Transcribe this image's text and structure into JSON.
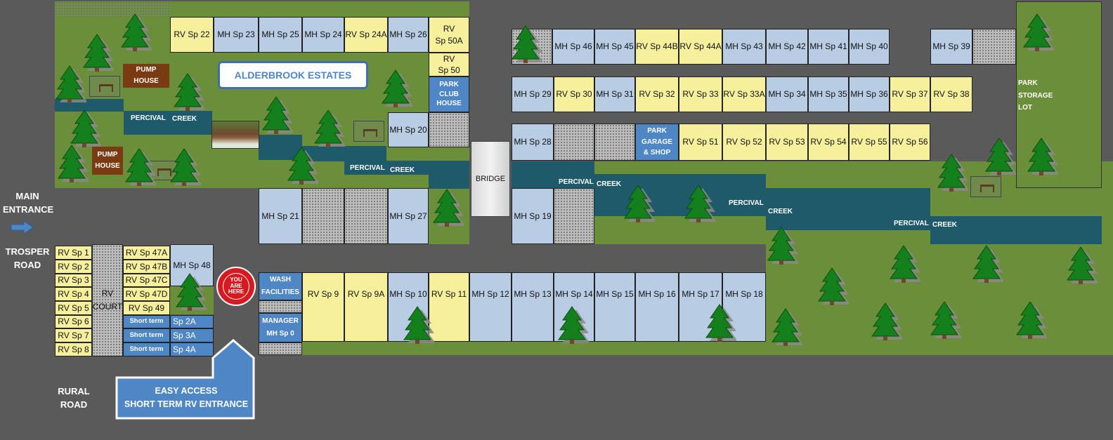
{
  "title": "ALDERBROOK ESTATES",
  "roads": {
    "main_entrance": [
      "MAIN",
      "ENTRANCE"
    ],
    "trosper_road": [
      "TROSPER",
      "ROAD"
    ],
    "rural_road": [
      "RURAL",
      "ROAD"
    ]
  },
  "easy_access": [
    "EASY ACCESS",
    "SHORT TERM RV ENTRANCE"
  ],
  "you_are_here": [
    "YOU",
    "ARE",
    "HERE"
  ],
  "bridge": "BRIDGE",
  "pump_house": [
    "PUMP",
    "HOUSE"
  ],
  "park_club_house": [
    "PARK",
    "CLUB",
    "HOUSE"
  ],
  "park_garage_shop": [
    "PARK",
    "GARAGE",
    "& SHOP"
  ],
  "park_storage_lot": [
    "PARK",
    "STORAGE",
    "LOT"
  ],
  "wash_facilities": [
    "WASH",
    "FACILITIES"
  ],
  "manager": [
    "MANAGER",
    "MH Sp 0"
  ],
  "rv_court": [
    "RV",
    "COURT"
  ],
  "creek_labels": {
    "percival": "PERCIVAL",
    "creek": "CREEK"
  },
  "lots": {
    "top_row": [
      "RV Sp 22",
      "MH Sp 23",
      "MH Sp 25",
      "MH Sp 24",
      "RV Sp 24A",
      "MH Sp 26"
    ],
    "rv_50a": [
      "RV",
      "Sp 50A"
    ],
    "rv_50": [
      "RV",
      "Sp 50"
    ],
    "mh_20": "MH Sp 20",
    "row_46": [
      "MH Sp 46",
      "MH Sp 45",
      "RV Sp 44B",
      "RV Sp 44A",
      "MH Sp 43",
      "MH Sp 42",
      "MH Sp 41",
      "MH Sp 40"
    ],
    "mh_39": "MH Sp 39",
    "row_29": [
      "MH Sp 29",
      "RV Sp 30",
      "MH Sp 31",
      "RV Sp 32",
      "RV Sp 33",
      "RV Sp 33A",
      "MH Sp 34",
      "MH Sp 35",
      "MH Sp 36",
      "RV Sp 37",
      "RV Sp 38"
    ],
    "mh_28": "MH Sp 28",
    "row_51": [
      "RV Sp 51",
      "RV Sp 52",
      "RV Sp 53",
      "RV Sp 54",
      "RV Sp 55",
      "RV Sp 56"
    ],
    "mh_21": "MH Sp 21",
    "mh_27": "MH Sp 27",
    "mh_19": "MH Sp 19",
    "rv_left": [
      "RV Sp 1",
      "RV Sp 2",
      "RV Sp 3",
      "RV Sp 4",
      "RV Sp 5",
      "RV Sp 6",
      "RV Sp 7",
      "RV Sp 8"
    ],
    "rv_47": [
      "RV Sp 47A",
      "RV Sp 47B",
      "RV Sp 47C",
      "RV Sp 47D",
      "RV Sp 49"
    ],
    "mh_48": "MH Sp 48",
    "short_term": [
      "Short term",
      "Short term",
      "Short term"
    ],
    "short_term_sp": [
      "Sp 2A",
      "Sp 3A",
      "Sp 4A"
    ],
    "bottom_row": [
      "RV Sp 9",
      "RV Sp 9A",
      "MH Sp 10",
      "RV Sp 11",
      "MH Sp 12",
      "MH Sp 13",
      "MH Sp 14",
      "MH Sp 15",
      "MH Sp 16",
      "MH Sp 17",
      "MH Sp 18"
    ]
  },
  "colors": {
    "road": "#5a5a5a",
    "grass": "#6b8e3a",
    "creek": "#1f5a6a",
    "rv_lot": "#f6f09c",
    "mh_lot": "#b8cce4",
    "facility": "#4f86c6",
    "pump_house": "#7a3b12",
    "you_are_here": "#d71920"
  }
}
